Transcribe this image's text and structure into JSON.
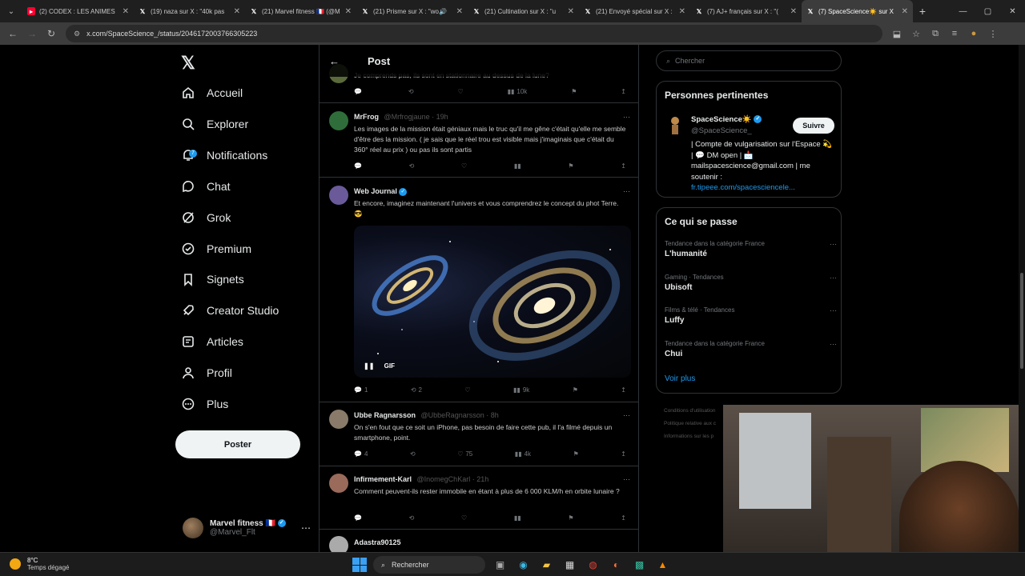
{
  "browser": {
    "tabs": [
      {
        "title": "(2) CODEX : LES ANIMES",
        "icon": "youtube-icon",
        "color": "#ff0033"
      },
      {
        "title": "(19) naza sur X : \"40k pas",
        "icon": "x-icon",
        "color": "#ffffff"
      },
      {
        "title": "(21) Marvel fitness 🇫🇷 (@M",
        "icon": "x-icon",
        "color": "#ffffff"
      },
      {
        "title": "(21) Prisme sur X : \"wo🔊",
        "icon": "x-icon",
        "color": "#ffffff"
      },
      {
        "title": "(21) Cultination sur X : \"u",
        "icon": "x-icon",
        "color": "#ffffff"
      },
      {
        "title": "(21) Envoyé spécial sur X :",
        "icon": "x-icon",
        "color": "#ffffff"
      },
      {
        "title": "(7) AJ+ français sur X : \"(",
        "icon": "x-icon",
        "color": "#ffffff"
      },
      {
        "title": "(7) SpaceScience☀️ sur X",
        "icon": "x-icon",
        "color": "#ffffff",
        "active": true
      }
    ],
    "url": "x.com/SpaceScience_/status/2046172003766305223"
  },
  "nav": {
    "items": [
      {
        "label": "Accueil",
        "icon": "home-icon"
      },
      {
        "label": "Explorer",
        "icon": "search-icon"
      },
      {
        "label": "Notifications",
        "icon": "bell-icon",
        "badge": "7"
      },
      {
        "label": "Chat",
        "icon": "chat-icon"
      },
      {
        "label": "Grok",
        "icon": "grok-icon"
      },
      {
        "label": "Premium",
        "icon": "premium-icon"
      },
      {
        "label": "Signets",
        "icon": "bookmark-icon"
      },
      {
        "label": "Creator Studio",
        "icon": "rocket-icon"
      },
      {
        "label": "Articles",
        "icon": "articles-icon"
      },
      {
        "label": "Profil",
        "icon": "profile-icon"
      },
      {
        "label": "Plus",
        "icon": "more-icon"
      }
    ],
    "post_label": "Poster",
    "account": {
      "name": "Marvel fitness 🇫🇷",
      "handle": "@Marvel_Flt"
    }
  },
  "main": {
    "title": "Post",
    "tweets": [
      {
        "name": "",
        "handle": "",
        "text": "Je comprends pas, ils sont en stationnaire au dessus de la lune?",
        "stats": [
          "",
          "",
          "",
          "10k"
        ]
      },
      {
        "name": "MrFrog",
        "handle": "@Mrfrogjaune · 19h",
        "text": "Les images de la mission était géniaux mais le truc qu'il me gêne c'était qu'elle me semble d'être des la mission. ( je sais que le réel trou est visible mais j'imaginais que c'était du 360° réel au prix ) ou pas ils sont partis",
        "stats": [
          "",
          "",
          "",
          ""
        ]
      },
      {
        "name": "Web Journal",
        "handle": "",
        "text": "Et encore, imaginez maintenant l'univers et vous comprendrez le concept du phot Terre. 😎",
        "stats": [
          "1",
          "2",
          "",
          "9k"
        ],
        "media_label": "GIF"
      },
      {
        "name": "Ubbe Ragnarsson",
        "handle": "@UbbeRagnarsson · 8h",
        "text": "On s'en fout que ce soit un iPhone, pas besoin de faire cette pub, il l'a filmé depuis un smartphone, point.",
        "stats": [
          "4",
          "",
          "75",
          "4k"
        ]
      },
      {
        "name": "Infirmement-Karl",
        "handle": "@InomegChKarl · 21h",
        "text": "Comment peuvent-ils rester immobile en étant à plus de 6 000 KLM/h en orbite lunaire ?",
        "stats": [
          "",
          "",
          "",
          ""
        ]
      },
      {
        "name": "Adastra90125",
        "handle": "",
        "text": "",
        "stats": []
      }
    ]
  },
  "right": {
    "search_placeholder": "Chercher",
    "relevant": {
      "title": "Personnes pertinentes",
      "name": "SpaceScience☀️",
      "handle": "@SpaceScience_",
      "follow_label": "Suivre",
      "bio": "| Compte de vulgarisation sur l'Espace 💫 | 💬 DM open | 📩 mailspacescience@gmail.com | me soutenir :",
      "link": "fr.tipeee.com/spacesciencele..."
    },
    "trends": {
      "title": "Ce qui se passe",
      "items": [
        {
          "category": "Tendance dans la catégorie France",
          "topic": "L'humanité"
        },
        {
          "category": "Gaming · Tendances",
          "topic": "Ubisoft"
        },
        {
          "category": "Films & télé · Tendances",
          "topic": "Luffy"
        },
        {
          "category": "Tendance dans la catégorie France",
          "topic": "Chui"
        }
      ],
      "more": "Voir plus"
    },
    "footer": [
      "Conditions d'utilisation",
      "Politique relative aux c",
      "Informations sur les p"
    ]
  },
  "taskbar": {
    "temp": "8°C",
    "condition": "Temps dégagé",
    "search": "Rechercher"
  }
}
